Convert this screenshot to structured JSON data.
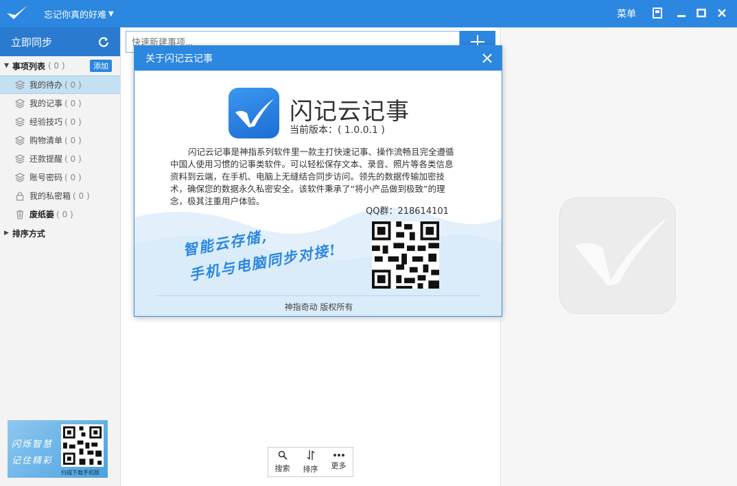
{
  "titlebar": {
    "user_name": "忘记你真的好难",
    "menu_label": "菜单"
  },
  "sidebar": {
    "sync_label": "立即同步",
    "group_title": "事项列表",
    "group_count": "( 0 )",
    "add_label": "添加",
    "items": [
      {
        "label": "我的待办",
        "count": "( 0 )"
      },
      {
        "label": "我的记事",
        "count": "( 0 )"
      },
      {
        "label": "经验技巧",
        "count": "( 0 )"
      },
      {
        "label": "购物清单",
        "count": "( 0 )"
      },
      {
        "label": "还款提醒",
        "count": "( 0 )"
      },
      {
        "label": "账号密码",
        "count": "( 0 )"
      },
      {
        "label": "我的私密箱",
        "count": "( 0 )"
      },
      {
        "label": "废纸篓",
        "count": "( 0 )"
      }
    ],
    "sort_label": "排序方式",
    "promo": {
      "line1": "闪烁智慧",
      "line2": "记住精彩",
      "caption": "扫描下载手机版"
    }
  },
  "middle": {
    "quick_placeholder": "快速新建事项...",
    "tools": [
      {
        "label": "搜索",
        "icon": "search-icon"
      },
      {
        "label": "排序",
        "icon": "sort-icon"
      },
      {
        "label": "更多",
        "icon": "more-icon"
      }
    ]
  },
  "about": {
    "title": "关于闪记云记事",
    "app_name": "闪记云记事",
    "version": "当前版本：( 1.0.0.1 )",
    "description": "闪记云记事是神指系列软件里一款主打快速记事、操作流畅且完全遵循中国人使用习惯的记事类软件。可以轻松保存文本、录音、照片等各类信息资料到云端，在手机、电脑上无缝结合同步访问。领先的数据传输加密技术，确保您的数据永久私密安全。该软件秉承了“将小产品做到极致”的理念，极其注重用户体验。",
    "slogan1": "智能云存储,",
    "slogan2": "手机与电脑同步对接!",
    "qq": "QQ群：218614101",
    "copyright": "神指奇动 版权所有"
  },
  "colors": {
    "accent": "#2b87e0",
    "sync_bg": "#2a7ad0",
    "active_item": "#c4e0f3"
  }
}
